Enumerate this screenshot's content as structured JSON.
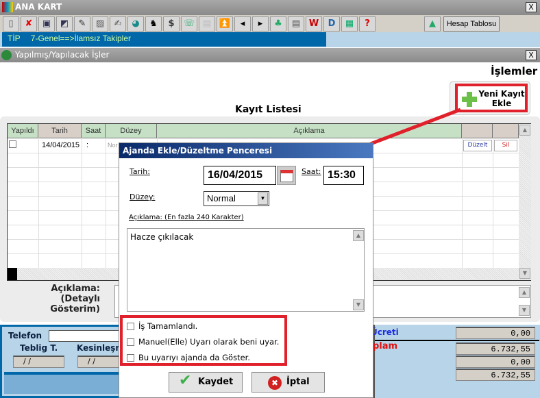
{
  "main_window": {
    "title": "ANA KART",
    "close": "X",
    "hesap_tablosu": "Hesap Tablosu",
    "tip_label": "TİP",
    "tip_value": "7-Genel==>İlamsız Takipler"
  },
  "toolbar_icons": [
    "new-doc-icon",
    "delete-icon",
    "preview-icon",
    "search-doc-icon",
    "edit-icon",
    "edit2-icon",
    "write-icon",
    "pie-icon",
    "walk-icon",
    "money-icon",
    "phone-icon",
    "clipboard-icon",
    "first-icon",
    "prev-icon",
    "next-icon",
    "tree-icon",
    "print-icon",
    "word-icon",
    "doc-icon",
    "calculator-icon",
    "help-icon",
    "add-image-icon"
  ],
  "sub_window": {
    "title": "Yapılmış/Yapılacak İşler",
    "close": "X",
    "islemler": "İşlemler",
    "new_record": "Yeni Kayıt Ekle",
    "list_title": "Kayıt Listesi"
  },
  "grid": {
    "columns": [
      "Yapıldı",
      "Tarih",
      "Saat",
      "Düzey",
      "Açıklama",
      "",
      ""
    ],
    "rows": [
      {
        "yapildi": false,
        "tarih": "14/04/2015",
        "saat": ":",
        "duzey": "Nor",
        "edit": "Düzelt",
        "delete": "Sil"
      }
    ]
  },
  "detail": {
    "label1": "Açıklama:",
    "label2": "(Detaylı",
    "label3": "Gösterim)"
  },
  "bottom": {
    "telefon": "Telefon",
    "teblig": "Teblig T.",
    "kesinlesme": "Kesinleşme",
    "date_placeholder": " /  /",
    "ucreti": "Ücreti",
    "toplam": "plam",
    "values": [
      "0,00",
      "6.732,55",
      "0,00",
      "6.732,55"
    ]
  },
  "dialog": {
    "title": "Ajanda Ekle/Düzeltme Penceresi",
    "tarih_label": "Tarih:",
    "tarih": "16/04/2015",
    "saat_label": "Saat:",
    "saat": "15:30",
    "duzey_label": "Düzey:",
    "duzey": "Normal",
    "aciklama_label": "Açıklama: (En fazla 240 Karakter)",
    "aciklama": "Hacze çıkılacak",
    "checks": [
      {
        "label": "İş Tamamlandı.",
        "checked": false
      },
      {
        "label": "Manuel(Elle) Uyarı olarak beni uyar.",
        "checked": false
      },
      {
        "label": "Bu uyarıyı ajanda da Göster.",
        "checked": false
      }
    ],
    "save": "Kaydet",
    "cancel": "İptal"
  },
  "colors": {
    "highlight": "#e0202a",
    "tip_bar": "#0067a8",
    "panel_blue": "#b8d4e8",
    "header_green": "#c5e0c5"
  }
}
